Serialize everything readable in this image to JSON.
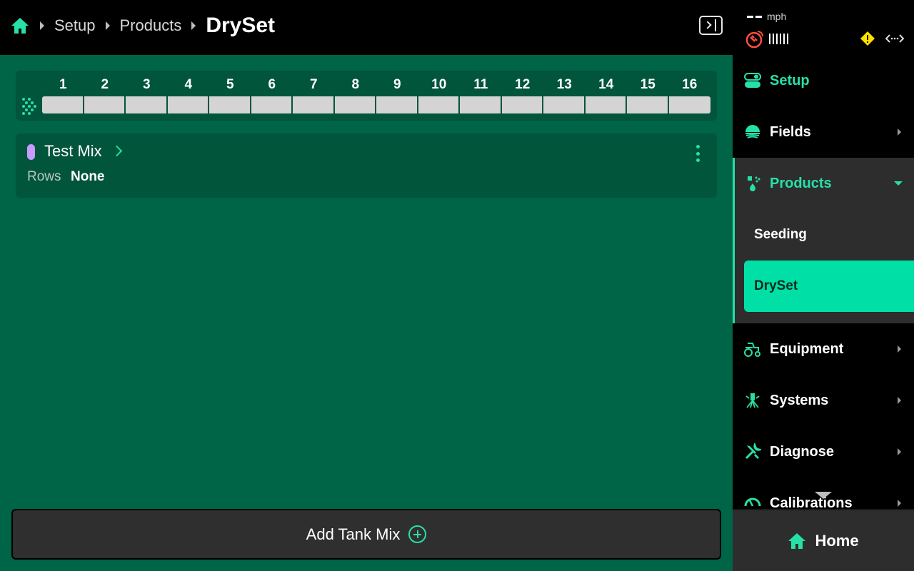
{
  "breadcrumb": {
    "items": [
      "Setup",
      "Products"
    ],
    "current": "DrySet"
  },
  "section_strip": {
    "sections": [
      "1",
      "2",
      "3",
      "4",
      "5",
      "6",
      "7",
      "8",
      "9",
      "10",
      "11",
      "12",
      "13",
      "14",
      "15",
      "16"
    ]
  },
  "tank_mix": {
    "name": "Test Mix",
    "color": "#c79cff",
    "rows_label": "Rows",
    "rows_value": "None"
  },
  "add_button": {
    "label": "Add Tank Mix"
  },
  "status": {
    "speed_value": "--",
    "speed_unit": "mph"
  },
  "nav": {
    "setup": "Setup",
    "fields": "Fields",
    "products": "Products",
    "products_sub": [
      "Seeding",
      "DrySet"
    ],
    "equipment": "Equipment",
    "systems": "Systems",
    "diagnose": "Diagnose",
    "calibrations": "Calibrations"
  },
  "home_button": {
    "label": "Home"
  },
  "colors": {
    "accent": "#27e0a8",
    "main_bg": "#006446",
    "card_bg": "#00553b",
    "selected_bg": "#00e0a6",
    "warning": "#ffe000"
  }
}
